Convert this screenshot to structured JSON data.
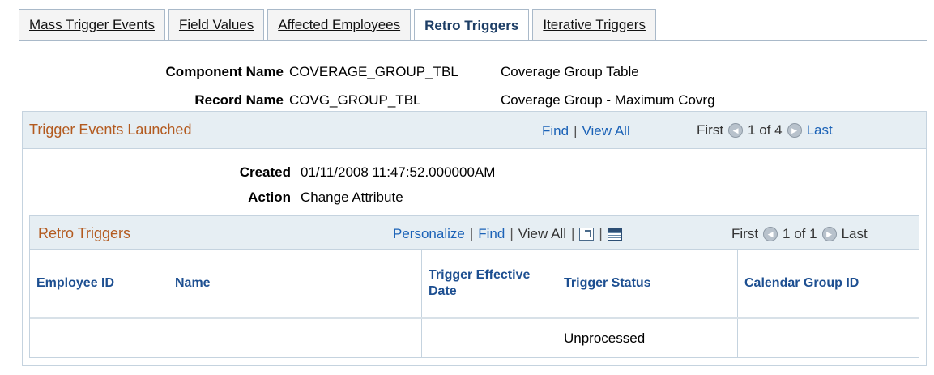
{
  "tabs": [
    {
      "label": "Mass Trigger Events",
      "active": false
    },
    {
      "label": "Field Values",
      "active": false
    },
    {
      "label": "Affected Employees",
      "active": false
    },
    {
      "label": "Retro Triggers",
      "active": true
    },
    {
      "label": "Iterative Triggers",
      "active": false
    }
  ],
  "header": {
    "component_label": "Component Name",
    "component_name": "COVERAGE_GROUP_TBL",
    "component_desc": "Coverage Group Table",
    "record_label": "Record Name",
    "record_name": "COVG_GROUP_TBL",
    "record_desc": "Coverage Group - Maximum Covrg"
  },
  "trigger_events": {
    "title": "Trigger Events Launched",
    "find": "Find",
    "sep": "|",
    "view_all": "View All",
    "first": "First",
    "count": "1 of 4",
    "last": "Last",
    "created_label": "Created",
    "created_value": "01/11/2008 11:47:52.000000AM",
    "action_label": "Action",
    "action_value": "Change Attribute"
  },
  "retro_triggers": {
    "title": "Retro Triggers",
    "personalize": "Personalize",
    "sep": "|",
    "find": "Find",
    "view_all": "View All",
    "zoom_icon": "zoom-icon",
    "download_icon": "spreadsheet-icon",
    "first": "First",
    "count": "1 of 1",
    "last": "Last",
    "columns": [
      "Employee ID",
      "Name",
      "Trigger Effective Date",
      "Trigger Status",
      "Calendar Group ID"
    ],
    "rows": [
      {
        "employee_id": "",
        "name": "",
        "trigger_effective_date": "",
        "trigger_status": "Unprocessed",
        "calendar_group_id": ""
      }
    ]
  },
  "colors": {
    "grid_title": "#b35a1f",
    "link": "#1b62b7",
    "header_bg": "#e6eef3",
    "column_header": "#1d4f91"
  }
}
